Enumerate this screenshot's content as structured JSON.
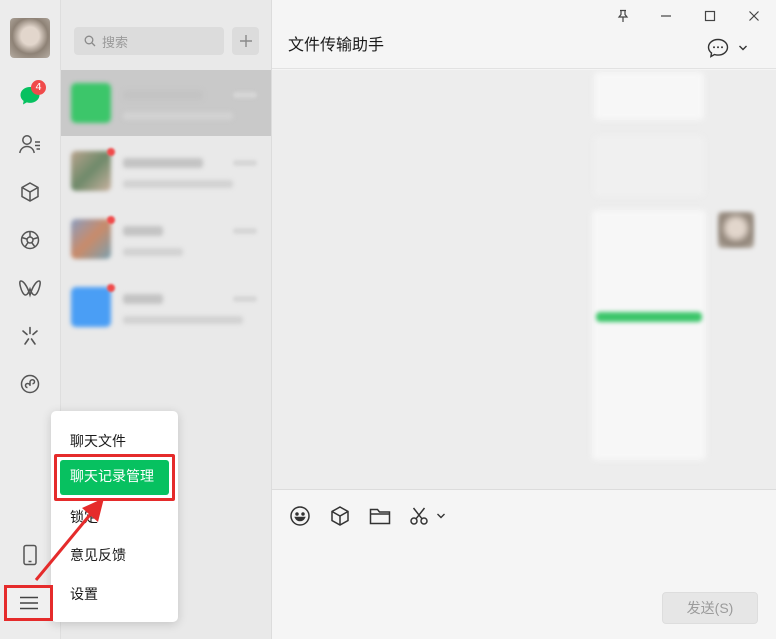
{
  "window": {
    "title": "文件传输助手"
  },
  "sidebar": {
    "unread_badge": "4",
    "icons": [
      "chat-icon",
      "contacts-icon",
      "cube-icon",
      "moments-icon",
      "channels-icon",
      "sparkle-icon",
      "miniprogram-icon",
      "phone-icon",
      "menu-icon"
    ]
  },
  "search": {
    "placeholder": "搜索"
  },
  "menu": {
    "items": [
      {
        "label": "聊天文件"
      },
      {
        "label": "聊天记录管理"
      },
      {
        "label": "锁定"
      },
      {
        "label": "意见反馈"
      },
      {
        "label": "设置"
      }
    ]
  },
  "composer": {
    "send_label": "发送(S)"
  },
  "colors": {
    "accent": "#07c160",
    "highlight": "#e52b2b",
    "badge": "#f04b4b"
  }
}
